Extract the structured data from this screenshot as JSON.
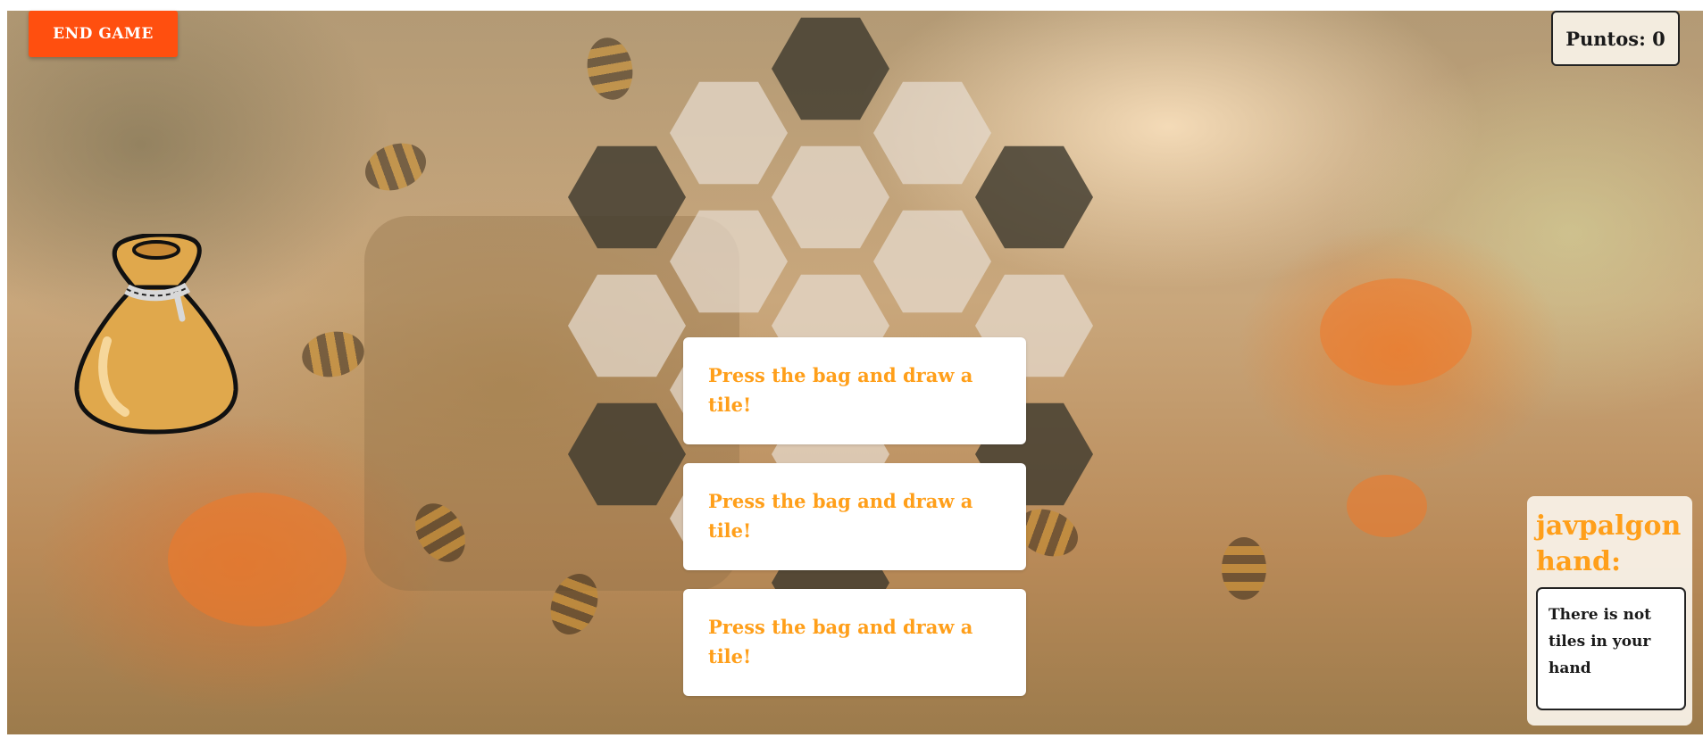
{
  "game": {
    "end_game_label": "END GAME",
    "score_label": "Puntos: 0"
  },
  "bag": {
    "icon": "tile-bag-icon"
  },
  "board": {
    "tile_colors": {
      "light": "#e6dbcf",
      "dark": "#3f3a2e"
    },
    "tiles": [
      {
        "row": 0,
        "col": 2,
        "state": "dark"
      },
      {
        "row": 1,
        "col": 1,
        "state": "light"
      },
      {
        "row": 1,
        "col": 3,
        "state": "light"
      },
      {
        "row": 2,
        "col": 0,
        "state": "dark"
      },
      {
        "row": 2,
        "col": 2,
        "state": "light"
      },
      {
        "row": 2,
        "col": 4,
        "state": "dark"
      },
      {
        "row": 3,
        "col": 1,
        "state": "light"
      },
      {
        "row": 3,
        "col": 3,
        "state": "light"
      },
      {
        "row": 4,
        "col": 0,
        "state": "light"
      },
      {
        "row": 4,
        "col": 2,
        "state": "light"
      },
      {
        "row": 4,
        "col": 4,
        "state": "light"
      },
      {
        "row": 5,
        "col": 1,
        "state": "light"
      },
      {
        "row": 5,
        "col": 3,
        "state": "light"
      },
      {
        "row": 6,
        "col": 0,
        "state": "dark"
      },
      {
        "row": 6,
        "col": 2,
        "state": "light"
      },
      {
        "row": 6,
        "col": 4,
        "state": "dark"
      },
      {
        "row": 7,
        "col": 1,
        "state": "light"
      },
      {
        "row": 7,
        "col": 3,
        "state": "light"
      },
      {
        "row": 8,
        "col": 2,
        "state": "dark"
      }
    ]
  },
  "messages": [
    "Press the bag and draw a tile!",
    "Press the bag and draw a tile!",
    "Press the bag and draw a tile!"
  ],
  "hand": {
    "title": "javpalgon hand:",
    "empty_text": "There is not tiles in your hand"
  },
  "colors": {
    "accent": "#ff4f0f",
    "message_text": "#ff9f1a"
  }
}
